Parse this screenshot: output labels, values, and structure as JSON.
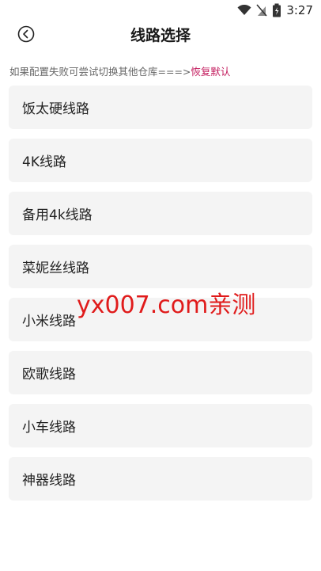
{
  "status": {
    "time": "3:27"
  },
  "header": {
    "title": "线路选择"
  },
  "hint": {
    "text": "如果配置失败可尝试切换其他仓库===>",
    "restore_label": "恢复默认"
  },
  "routes": [
    {
      "label": "饭太硬线路"
    },
    {
      "label": "4K线路"
    },
    {
      "label": "备用4k线路"
    },
    {
      "label": "菜妮丝线路"
    },
    {
      "label": "小米线路"
    },
    {
      "label": "欧歌线路"
    },
    {
      "label": "小车线路"
    },
    {
      "label": "神器线路"
    }
  ],
  "watermark": {
    "text": "yx007.com亲测"
  },
  "colors": {
    "accent": "#c2185b",
    "watermark": "#e01b1b",
    "item_bg": "#f4f4f4"
  }
}
